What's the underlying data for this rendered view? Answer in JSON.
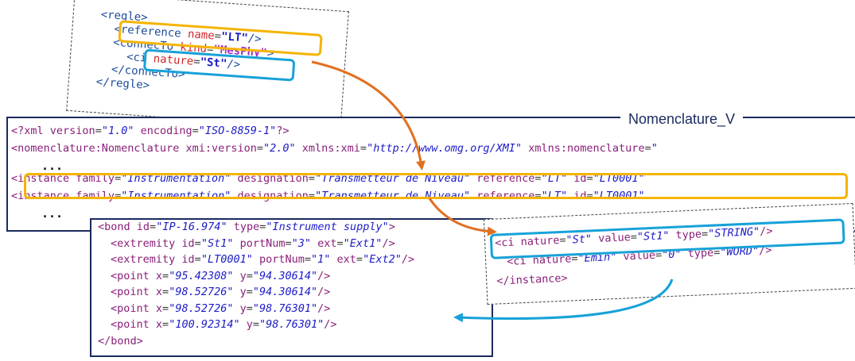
{
  "regle": {
    "lines": [
      {
        "indent": 0,
        "tokens": [
          {
            "c": "tag",
            "t": "<regle>"
          }
        ]
      },
      {
        "indent": 1,
        "tokens": [
          {
            "c": "tag",
            "t": "<reference "
          },
          {
            "c": "aname",
            "t": "name"
          },
          {
            "c": "punct",
            "t": "="
          },
          {
            "c": "val",
            "t": "\"LT\""
          },
          {
            "c": "tag",
            "t": "/>"
          }
        ]
      },
      {
        "indent": 1,
        "tokens": [
          {
            "c": "tag",
            "t": "<connecTo "
          },
          {
            "c": "aname",
            "t": "kind"
          },
          {
            "c": "punct",
            "t": "="
          },
          {
            "c": "mesphy",
            "t": "\"MesPhy\""
          },
          {
            "c": "tag",
            "t": ">"
          }
        ]
      },
      {
        "indent": 2,
        "tokens": [
          {
            "c": "tag",
            "t": "<ci "
          },
          {
            "c": "aname",
            "t": "nature"
          },
          {
            "c": "punct",
            "t": "="
          },
          {
            "c": "val",
            "t": "\"St\""
          },
          {
            "c": "tag",
            "t": "/>"
          }
        ]
      },
      {
        "indent": 1,
        "tokens": [
          {
            "c": "tag",
            "t": "</connecTo>"
          }
        ]
      },
      {
        "indent": 0,
        "tokens": [
          {
            "c": "tag",
            "t": "</regle>"
          }
        ]
      }
    ]
  },
  "nomenclature": {
    "title": "Nomenclature_V",
    "lines": [
      {
        "indent": 0,
        "tokens": [
          {
            "c": "tag",
            "t": "<?xml "
          },
          {
            "c": "attr",
            "t": "version"
          },
          {
            "c": "punct",
            "t": "="
          },
          {
            "c": "val",
            "t": "\"1.0\""
          },
          {
            "c": "attr",
            "t": " encoding"
          },
          {
            "c": "punct",
            "t": "="
          },
          {
            "c": "val",
            "t": "\"ISO-8859-1\""
          },
          {
            "c": "tag",
            "t": "?>"
          }
        ]
      },
      {
        "indent": 0,
        "tokens": [
          {
            "c": "tag",
            "t": "<nomenclature:Nomenclature "
          },
          {
            "c": "attr",
            "t": "xmi:version"
          },
          {
            "c": "punct",
            "t": "="
          },
          {
            "c": "val",
            "t": "\"2.0\""
          },
          {
            "c": "attr",
            "t": " xmlns:xmi"
          },
          {
            "c": "punct",
            "t": "="
          },
          {
            "c": "val",
            "t": "\"http://www.omg.org/XMI\""
          },
          {
            "c": "attr",
            "t": " xmlns:nomenclature"
          },
          {
            "c": "punct",
            "t": "="
          },
          {
            "c": "val",
            "t": "\""
          }
        ]
      },
      {
        "indent": 0,
        "tokens": [
          {
            "c": "tag",
            "t": "<instance "
          },
          {
            "c": "attr",
            "t": "family"
          },
          {
            "c": "punct",
            "t": "="
          },
          {
            "c": "val",
            "t": "\"Instrumentation\""
          },
          {
            "c": "attr",
            "t": " designation"
          },
          {
            "c": "punct",
            "t": "="
          },
          {
            "c": "val",
            "t": "\"Transmetteur de Niveau\""
          },
          {
            "c": "attr",
            "t": " reference"
          },
          {
            "c": "punct",
            "t": "="
          },
          {
            "c": "val",
            "t": "\"LT\""
          },
          {
            "c": "attr",
            "t": " id"
          },
          {
            "c": "punct",
            "t": "="
          },
          {
            "c": "val",
            "t": "\"LT0001\""
          }
        ]
      },
      {
        "indent": 0,
        "tokens": [
          {
            "c": "tag",
            "t": "<instance "
          },
          {
            "c": "attr",
            "t": "family"
          },
          {
            "c": "punct",
            "t": "="
          },
          {
            "c": "val",
            "t": "\"Instrumentation\""
          },
          {
            "c": "attr",
            "t": " designation"
          },
          {
            "c": "punct",
            "t": "="
          },
          {
            "c": "val",
            "t": "\"Transmetteur de Niveau\""
          },
          {
            "c": "attr",
            "t": " reference"
          },
          {
            "c": "punct",
            "t": "="
          },
          {
            "c": "val",
            "t": "\"LT\""
          },
          {
            "c": "attr",
            "t": " id"
          },
          {
            "c": "punct",
            "t": "="
          },
          {
            "c": "val",
            "t": "\"LT0001\""
          }
        ]
      }
    ],
    "ellipsis": "..."
  },
  "bond": {
    "lines": [
      {
        "indent": 0,
        "tokens": [
          {
            "c": "tag",
            "t": "<bond "
          },
          {
            "c": "attr",
            "t": "id"
          },
          {
            "c": "punct",
            "t": "="
          },
          {
            "c": "val",
            "t": "\"IP-16.974\""
          },
          {
            "c": "attr",
            "t": " type"
          },
          {
            "c": "punct",
            "t": "="
          },
          {
            "c": "val",
            "t": "\"Instrument supply\""
          },
          {
            "c": "tag",
            "t": ">"
          }
        ]
      },
      {
        "indent": 1,
        "tokens": [
          {
            "c": "tag",
            "t": "<extremity "
          },
          {
            "c": "attr",
            "t": "id"
          },
          {
            "c": "punct",
            "t": "="
          },
          {
            "c": "val",
            "t": "\"St1\""
          },
          {
            "c": "attr",
            "t": " portNum"
          },
          {
            "c": "punct",
            "t": "="
          },
          {
            "c": "val",
            "t": "\"3\""
          },
          {
            "c": "attr",
            "t": " ext"
          },
          {
            "c": "punct",
            "t": "="
          },
          {
            "c": "val",
            "t": "\"Ext1\""
          },
          {
            "c": "tag",
            "t": "/>"
          }
        ]
      },
      {
        "indent": 1,
        "tokens": [
          {
            "c": "tag",
            "t": "<extremity "
          },
          {
            "c": "attr",
            "t": "id"
          },
          {
            "c": "punct",
            "t": "="
          },
          {
            "c": "val",
            "t": "\"LT0001\""
          },
          {
            "c": "attr",
            "t": " portNum"
          },
          {
            "c": "punct",
            "t": "="
          },
          {
            "c": "val",
            "t": "\"1\""
          },
          {
            "c": "attr",
            "t": " ext"
          },
          {
            "c": "punct",
            "t": "="
          },
          {
            "c": "val",
            "t": "\"Ext2\""
          },
          {
            "c": "tag",
            "t": "/>"
          }
        ]
      },
      {
        "indent": 1,
        "tokens": [
          {
            "c": "tag",
            "t": "<point "
          },
          {
            "c": "attr",
            "t": "x"
          },
          {
            "c": "punct",
            "t": "="
          },
          {
            "c": "val",
            "t": "\"95.42308\""
          },
          {
            "c": "attr",
            "t": " y"
          },
          {
            "c": "punct",
            "t": "="
          },
          {
            "c": "val",
            "t": "\"94.30614\""
          },
          {
            "c": "tag",
            "t": "/>"
          }
        ]
      },
      {
        "indent": 1,
        "tokens": [
          {
            "c": "tag",
            "t": "<point "
          },
          {
            "c": "attr",
            "t": "x"
          },
          {
            "c": "punct",
            "t": "="
          },
          {
            "c": "val",
            "t": "\"98.52726\""
          },
          {
            "c": "attr",
            "t": " y"
          },
          {
            "c": "punct",
            "t": "="
          },
          {
            "c": "val",
            "t": "\"94.30614\""
          },
          {
            "c": "tag",
            "t": "/>"
          }
        ]
      },
      {
        "indent": 1,
        "tokens": [
          {
            "c": "tag",
            "t": "<point "
          },
          {
            "c": "attr",
            "t": "x"
          },
          {
            "c": "punct",
            "t": "="
          },
          {
            "c": "val",
            "t": "\"98.52726\""
          },
          {
            "c": "attr",
            "t": " y"
          },
          {
            "c": "punct",
            "t": "="
          },
          {
            "c": "val",
            "t": "\"98.76301\""
          },
          {
            "c": "tag",
            "t": "/>"
          }
        ]
      },
      {
        "indent": 1,
        "tokens": [
          {
            "c": "tag",
            "t": "<point "
          },
          {
            "c": "attr",
            "t": "x"
          },
          {
            "c": "punct",
            "t": "="
          },
          {
            "c": "val",
            "t": "\"100.92314\""
          },
          {
            "c": "attr",
            "t": " y"
          },
          {
            "c": "punct",
            "t": "="
          },
          {
            "c": "val",
            "t": "\"98.76301\""
          },
          {
            "c": "tag",
            "t": "/>"
          }
        ]
      },
      {
        "indent": 0,
        "tokens": [
          {
            "c": "tag",
            "t": "</bond>"
          }
        ]
      }
    ]
  },
  "ci": {
    "lines": [
      {
        "indent": 0,
        "tokens": [
          {
            "c": "tag",
            "t": "<ci "
          },
          {
            "c": "attr",
            "t": "nature"
          },
          {
            "c": "punct",
            "t": "="
          },
          {
            "c": "val",
            "t": "\"St\""
          },
          {
            "c": "attr",
            "t": " value"
          },
          {
            "c": "punct",
            "t": "="
          },
          {
            "c": "val",
            "t": "\"St1\""
          },
          {
            "c": "attr",
            "t": " type"
          },
          {
            "c": "punct",
            "t": "="
          },
          {
            "c": "val",
            "t": "\"STRING\""
          },
          {
            "c": "tag",
            "t": "/>"
          }
        ]
      },
      {
        "indent": 1,
        "tokens": [
          {
            "c": "tag",
            "t": "<ci "
          },
          {
            "c": "attr",
            "t": "nature"
          },
          {
            "c": "punct",
            "t": "="
          },
          {
            "c": "val",
            "t": "\"Emin\""
          },
          {
            "c": "attr",
            "t": " value"
          },
          {
            "c": "punct",
            "t": "="
          },
          {
            "c": "val",
            "t": "\"0\""
          },
          {
            "c": "attr",
            "t": " type"
          },
          {
            "c": "punct",
            "t": "="
          },
          {
            "c": "val",
            "t": "\"WORD\""
          },
          {
            "c": "tag",
            "t": "/>"
          }
        ]
      },
      {
        "indent": 0,
        "tokens": [
          {
            "c": "tag",
            "t": "</instance>"
          }
        ]
      }
    ]
  },
  "colors": {
    "highlight_orange": "#f5b400",
    "highlight_blue": "#17a2d8",
    "arrow_orange": "#e07020",
    "arrow_blue": "#17a2d8",
    "panel_border": "#1a2a5e"
  }
}
